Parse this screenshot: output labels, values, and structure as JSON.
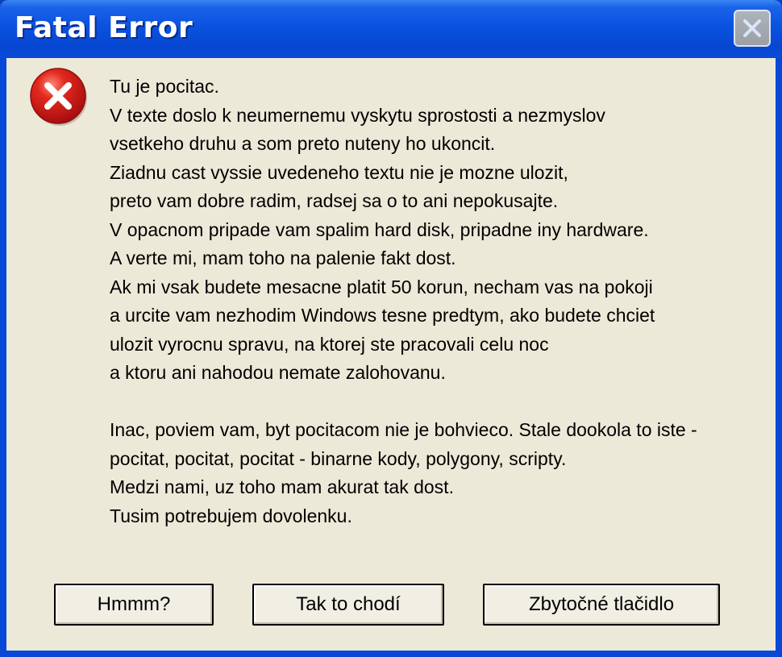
{
  "window": {
    "title": "Fatal Error",
    "close_icon": "close-icon"
  },
  "dialog": {
    "icon": "error-icon",
    "message_lines": [
      "Tu je pocitac.",
      "V texte doslo k neumernemu vyskytu sprostosti a nezmyslov",
      "vsetkeho druhu a som preto nuteny ho ukoncit.",
      "Ziadnu cast vyssie uvedeneho textu nie je mozne ulozit,",
      "preto vam dobre radim, radsej sa o to ani nepokusajte.",
      "V opacnom pripade vam spalim hard disk, pripadne iny hardware.",
      "A verte mi, mam toho na palenie fakt dost.",
      "Ak mi vsak budete mesacne platit 50 korun, necham vas na pokoji",
      "a urcite vam nezhodim Windows tesne predtym, ako budete chciet",
      "ulozit vyrocnu spravu, na ktorej ste pracovali celu noc",
      "a ktoru ani nahodou nemate zalohovanu.",
      "",
      "Inac, poviem vam, byt pocitacom nie je bohvieco. Stale dookola to iste -",
      "pocitat, pocitat, pocitat - binarne kody, polygony, scripty.",
      "Medzi nami, uz toho mam akurat tak dost.",
      "Tusim potrebujem dovolenku."
    ]
  },
  "buttons": {
    "first": "Hmmm?",
    "second": "Tak to chodí",
    "third": "Zbytočné tlačidlo"
  },
  "colors": {
    "titlebar": "#0a52e0",
    "dialog_bg": "#ece9d8",
    "error_red": "#d21f1f"
  }
}
